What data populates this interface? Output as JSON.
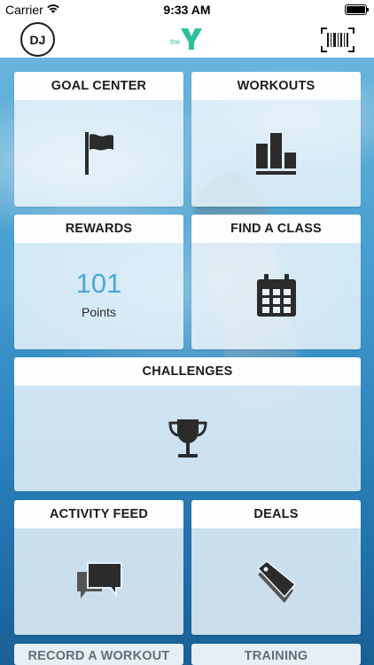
{
  "status_bar": {
    "carrier": "Carrier",
    "time": "9:33 AM"
  },
  "nav": {
    "avatar_initials": "DJ",
    "logo_text": "the",
    "icons": [
      "ymca-logo",
      "barcode-scan-icon"
    ]
  },
  "tiles": {
    "goal_center": {
      "title": "GOAL CENTER",
      "icon": "flag-icon"
    },
    "workouts": {
      "title": "WORKOUTS",
      "icon": "podium-icon"
    },
    "rewards": {
      "title": "REWARDS",
      "value": "101",
      "unit": "Points"
    },
    "find_a_class": {
      "title": "FIND A CLASS",
      "icon": "calendar-icon"
    },
    "challenges": {
      "title": "CHALLENGES",
      "icon": "trophy-icon"
    },
    "activity_feed": {
      "title": "ACTIVITY FEED",
      "icon": "chat-bubbles-icon"
    },
    "deals": {
      "title": "DEALS",
      "icon": "tags-icon"
    },
    "record_a_workout": {
      "title": "RECORD A WORKOUT"
    },
    "training": {
      "title": "TRAINING"
    }
  },
  "colors": {
    "accent": "#4ca8d8",
    "icon": "#2b2b2b",
    "ymca_green": "#2fbf9a"
  }
}
